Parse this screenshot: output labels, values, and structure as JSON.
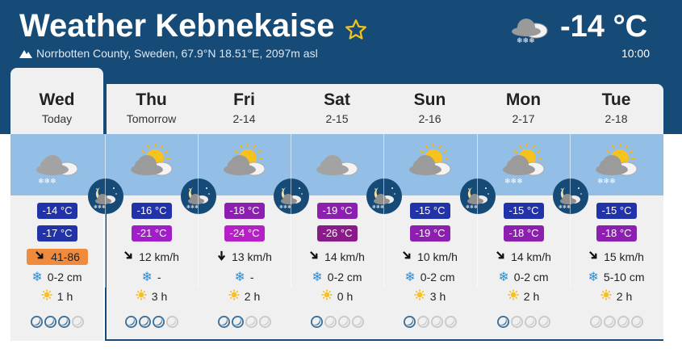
{
  "header": {
    "title": "Weather Kebnekaise",
    "location": "Norrbotten County, Sweden, 67.9°N 18.51°E, 2097m asl",
    "current_temp": "-14 °C",
    "current_time": "10:00"
  },
  "days": [
    {
      "name": "Wed",
      "sub": "Today",
      "t1": "-14 °C",
      "t2": "-17 °C",
      "gust": "41-86",
      "wind": "",
      "snow": "0-2 cm",
      "sun": "1 h"
    },
    {
      "name": "Thu",
      "sub": "Tomorrow",
      "t1": "-16 °C",
      "t2": "-21 °C",
      "wind": "12 km/h",
      "snow": "-",
      "sun": "3 h"
    },
    {
      "name": "Fri",
      "sub": "2-14",
      "t1": "-18 °C",
      "t2": "-24 °C",
      "wind": "13 km/h",
      "snow": "-",
      "sun": "2 h"
    },
    {
      "name": "Sat",
      "sub": "2-15",
      "t1": "-19 °C",
      "t2": "-26 °C",
      "wind": "14 km/h",
      "snow": "0-2 cm",
      "sun": "0 h"
    },
    {
      "name": "Sun",
      "sub": "2-16",
      "t1": "-15 °C",
      "t2": "-19 °C",
      "wind": "10 km/h",
      "snow": "0-2 cm",
      "sun": "3 h"
    },
    {
      "name": "Mon",
      "sub": "2-17",
      "t1": "-15 °C",
      "t2": "-18 °C",
      "wind": "14 km/h",
      "snow": "0-2 cm",
      "sun": "2 h"
    },
    {
      "name": "Tue",
      "sub": "2-18",
      "t1": "-15 °C",
      "t2": "-18 °C",
      "wind": "15 km/h",
      "snow": "5-10 cm",
      "sun": "2 h"
    }
  ],
  "colors": {
    "header_bg": "#164a77",
    "sky_band": "#93bfe6",
    "temp_blue": "#2233aa",
    "temp_purple": "#8c1fb0",
    "gust_orange": "#f08a3c"
  }
}
